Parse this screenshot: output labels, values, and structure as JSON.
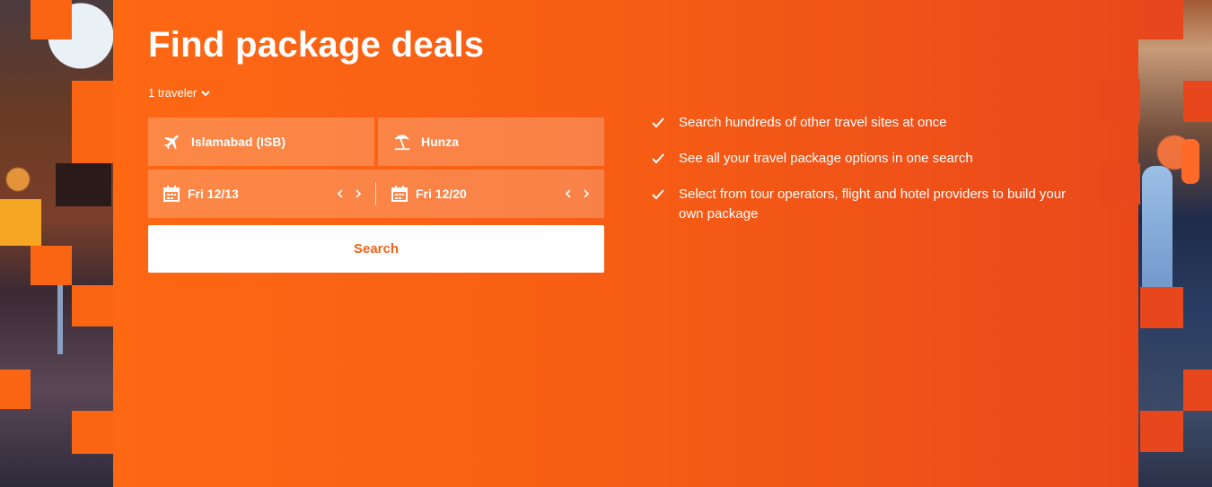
{
  "page": {
    "title": "Find package deals",
    "colors": {
      "accent": "#ff6a13",
      "accent_end": "#e8451c",
      "button_text": "#f0621a"
    }
  },
  "travelers": {
    "label": "1 traveler",
    "icon": "chevron-down-icon"
  },
  "search": {
    "origin": {
      "value": "Islamabad (ISB)",
      "icon": "airplane-icon"
    },
    "destination": {
      "value": "Hunza",
      "icon": "beach-icon"
    },
    "depart": {
      "value": "Fri 12/13",
      "icon": "calendar-icon"
    },
    "return": {
      "value": "Fri 12/20",
      "icon": "calendar-icon"
    },
    "button_label": "Search"
  },
  "benefits": [
    "Search hundreds of other travel sites at once",
    "See all your travel package options in one search",
    "Select from tour operators, flight and hotel providers to build your own package"
  ]
}
